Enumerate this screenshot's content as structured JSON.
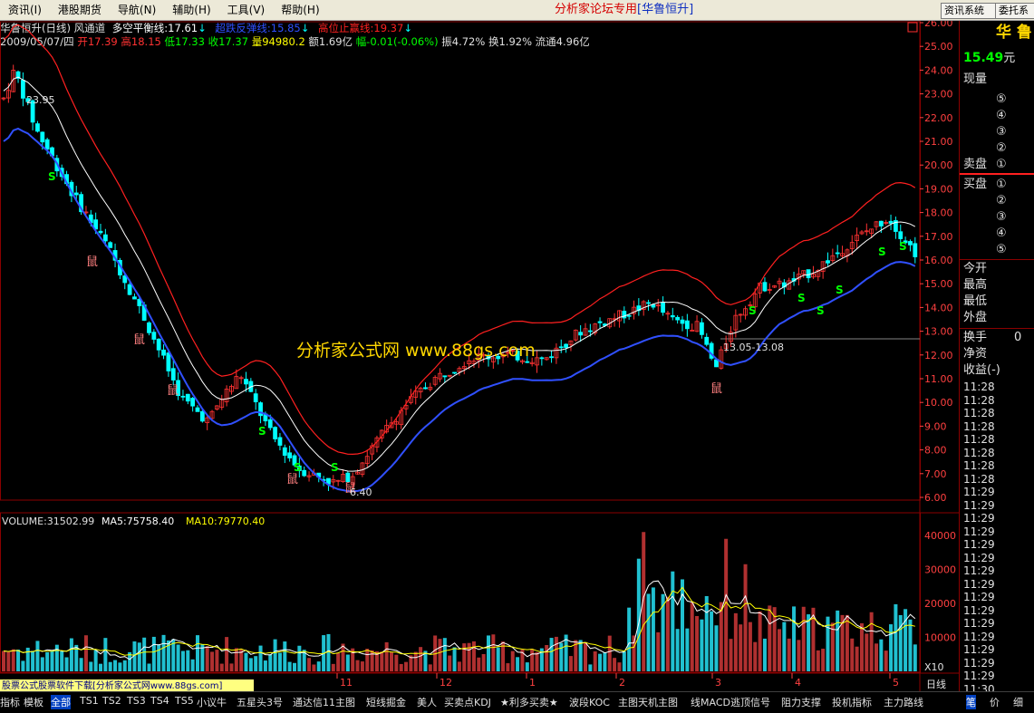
{
  "menubar": {
    "items": [
      "资讯(I)",
      "港股期货",
      "导航(N)",
      "辅助(H)",
      "工具(V)",
      "帮助(H)"
    ],
    "title": "分析家论坛专用",
    "title_stock": "[华鲁恒升]",
    "btn_info": "资讯系统",
    "btn_order": "委托系"
  },
  "chart_header": {
    "name": "华鲁恒升(日线)",
    "indicator": "风通道",
    "balance_label": "多空平衡线:",
    "balance_value": "17.61",
    "support_label": "超跌反弹线:",
    "support_value": "15.85",
    "resist_label": "高位止赢线:",
    "resist_value": "19.37",
    "date": "2009/05/07/四",
    "open": "开17.39",
    "high": "高18.15",
    "low": "低17.33",
    "close": "收17.37",
    "volume": "量94980.2",
    "amount": "额1.69亿",
    "change": "幅-0.01(-0.06%)",
    "amplitude": "振4.72%",
    "turnover": "换1.92%",
    "float": "流通4.96亿"
  },
  "volume_header": {
    "volume": "VOLUME:31502.99",
    "ma5": "MA5:75758.40",
    "ma10": "MA10:79770.40"
  },
  "annotations": {
    "high_mark": "23.95",
    "low_mark": "6.40",
    "range_mark": "13.05-13.08",
    "watermark": "分析家公式网 www.88gs.com",
    "rat": "鼠",
    "s": "S",
    "x10": "X10",
    "footer_link": "股票公式股票软件下载[分析家公式网www.88gs.com]"
  },
  "price_axis": [
    "26.00",
    "25.00",
    "24.00",
    "23.00",
    "22.00",
    "21.00",
    "20.00",
    "19.00",
    "18.00",
    "17.00",
    "16.00",
    "15.00",
    "14.00",
    "13.00",
    "12.00",
    "11.00",
    "10.00",
    "9.00",
    "8.00",
    "7.00",
    "6.00"
  ],
  "vol_axis": [
    "40000",
    "30000",
    "20000",
    "10000",
    "X10"
  ],
  "time_axis": [
    "11",
    "12",
    "1",
    "2",
    "3",
    "4",
    "5"
  ],
  "time_axis_label": "日线",
  "right_panel": {
    "stock": "华 鲁",
    "price": "15.49",
    "unit": "元",
    "now_qty": "现量",
    "sell_label": "卖盘",
    "buy_label": "买盘",
    "sell_levels": [
      "⑤",
      "④",
      "③",
      "②",
      "①"
    ],
    "buy_levels": [
      "①",
      "②",
      "③",
      "④",
      "⑤"
    ],
    "open_label": "今开",
    "high_label": "最高",
    "low_label": "最低",
    "outer_label": "外盘",
    "turn_label": "换手",
    "nav_label": "净资",
    "eps_label": "收益(-)",
    "turn_value": "0",
    "times": [
      "11:28",
      "11:28",
      "11:28",
      "11:28",
      "11:28",
      "11:28",
      "11:28",
      "11:28",
      "11:29",
      "11:29",
      "11:29",
      "11:29",
      "11:29",
      "11:29",
      "11:29",
      "11:29",
      "11:29",
      "11:29",
      "11:29",
      "11:29",
      "11:29",
      "11:29",
      "11:29",
      "11:30"
    ]
  },
  "bottom_tabs": [
    "指标",
    "模板",
    "全部",
    "TS1",
    "TS2",
    "TS3",
    "TS4",
    "TS5",
    "小议牛",
    "五星头3号",
    "通达信11主图",
    "短线掘金",
    "美人",
    "买卖点KDJ",
    "★利多买卖★",
    "波段KOC",
    "主图天机主图",
    "线MACD",
    "逃顶信号",
    "阻力支撑",
    "投机指标",
    "主力路线"
  ],
  "bottom_right": [
    "笔",
    "价",
    "细"
  ],
  "colors": {
    "up": "#ff3232",
    "down": "#00ffff",
    "upper_band": "#ff2020",
    "middle_band": "#ffffff",
    "lower_band": "#3050ff",
    "grid": "#8b0000",
    "ma5": "#ffffff",
    "ma10": "#ffff00",
    "watermark": "#ffd700"
  }
}
